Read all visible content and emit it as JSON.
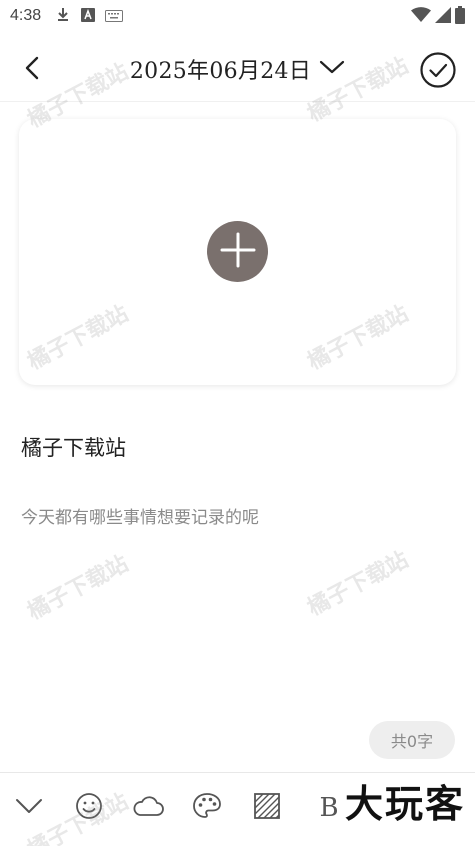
{
  "status_bar": {
    "time": "4:38",
    "left_icons": [
      "download-icon",
      "text-a-icon",
      "keyboard-icon"
    ],
    "right_icons": [
      "wifi-icon",
      "signal-icon",
      "battery-icon"
    ]
  },
  "header": {
    "back_icon": "chevron-left-icon",
    "date": "2025年06月24日",
    "dropdown_icon": "chevron-down-icon",
    "confirm_icon": "check-circle-icon"
  },
  "photo": {
    "add_icon": "plus-icon"
  },
  "editor": {
    "title": "橘子下载站",
    "body_placeholder": "今天都有哪些事情想要记录的呢",
    "word_count": "共0字"
  },
  "toolbar": {
    "items": [
      {
        "icon": "collapse-chevron-icon"
      },
      {
        "icon": "emoji-icon"
      },
      {
        "icon": "weather-cloud-icon"
      },
      {
        "icon": "palette-icon"
      },
      {
        "icon": "texture-icon"
      },
      {
        "label": "B"
      }
    ]
  },
  "watermark": {
    "text": "橘子下载站",
    "logo": "大玩客"
  },
  "colors": {
    "add_button": "#7a706d",
    "word_count_bg": "#eeeeee",
    "placeholder": "#8a8a8a"
  }
}
